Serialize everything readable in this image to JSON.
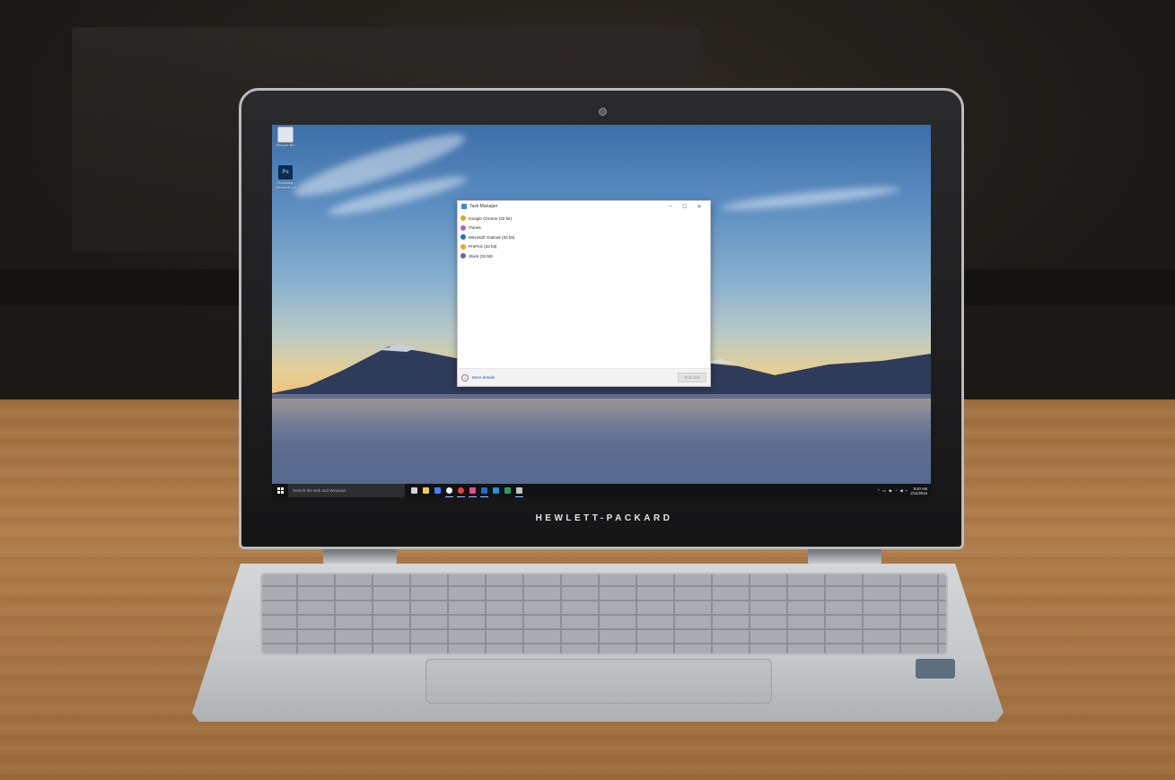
{
  "device": {
    "brand_text": "HEWLETT-PACKARD"
  },
  "desktop": {
    "icons": [
      {
        "label": "Recycle Bin",
        "icon": "recycle-bin-icon"
      },
      {
        "label": "Photoshop Elements 14",
        "icon": "photoshop-icon",
        "badge": "Ps"
      }
    ]
  },
  "task_manager": {
    "title": "Task Manager",
    "window_controls": {
      "minimize": "–",
      "maximize": "☐",
      "close": "✕"
    },
    "processes": [
      {
        "name": "Google Chrome (32 bit)",
        "icon": "chrome-icon",
        "color": "#e0a32b"
      },
      {
        "name": "iTunes",
        "icon": "itunes-icon",
        "color": "#c85ac8"
      },
      {
        "name": "Microsoft Outlook (32 bit)",
        "icon": "outlook-icon",
        "color": "#1e6fc8"
      },
      {
        "name": "ProPick (32 bit)",
        "icon": "app-icon",
        "color": "#f0a020"
      },
      {
        "name": "Slack (32 bit)",
        "icon": "slack-icon",
        "color": "#7a5aa0"
      }
    ],
    "more_details_label": "More details",
    "end_task_label": "End task"
  },
  "taskbar": {
    "search_placeholder": "Search the web and Windows",
    "apps": [
      {
        "icon": "task-view-icon",
        "color": "#cfd3d8",
        "active": false
      },
      {
        "icon": "file-explorer-icon",
        "color": "#f2c94c",
        "active": false
      },
      {
        "icon": "checkmark-app-icon",
        "color": "#3b82f6",
        "active": false
      },
      {
        "icon": "itunes-icon",
        "color": "#f5f5f5",
        "active": true
      },
      {
        "icon": "chrome-icon",
        "color": "#e94235",
        "active": true
      },
      {
        "icon": "photos-icon",
        "color": "#e94b8a",
        "active": true
      },
      {
        "icon": "outlook-icon",
        "color": "#1e6fc8",
        "active": true
      },
      {
        "icon": "photoshop-icon",
        "color": "#2a8fd6",
        "active": false
      },
      {
        "icon": "excel-icon",
        "color": "#21a366",
        "active": false
      },
      {
        "icon": "slack-icon",
        "color": "#c0c4c8",
        "active": true
      }
    ],
    "tray": {
      "chevron": "^",
      "icons": [
        "network-icon",
        "dropbox-icon",
        "wifi-icon",
        "volume-icon",
        "notification-icon"
      ],
      "time": "9:40 AM",
      "date": "2/12/2016"
    }
  }
}
